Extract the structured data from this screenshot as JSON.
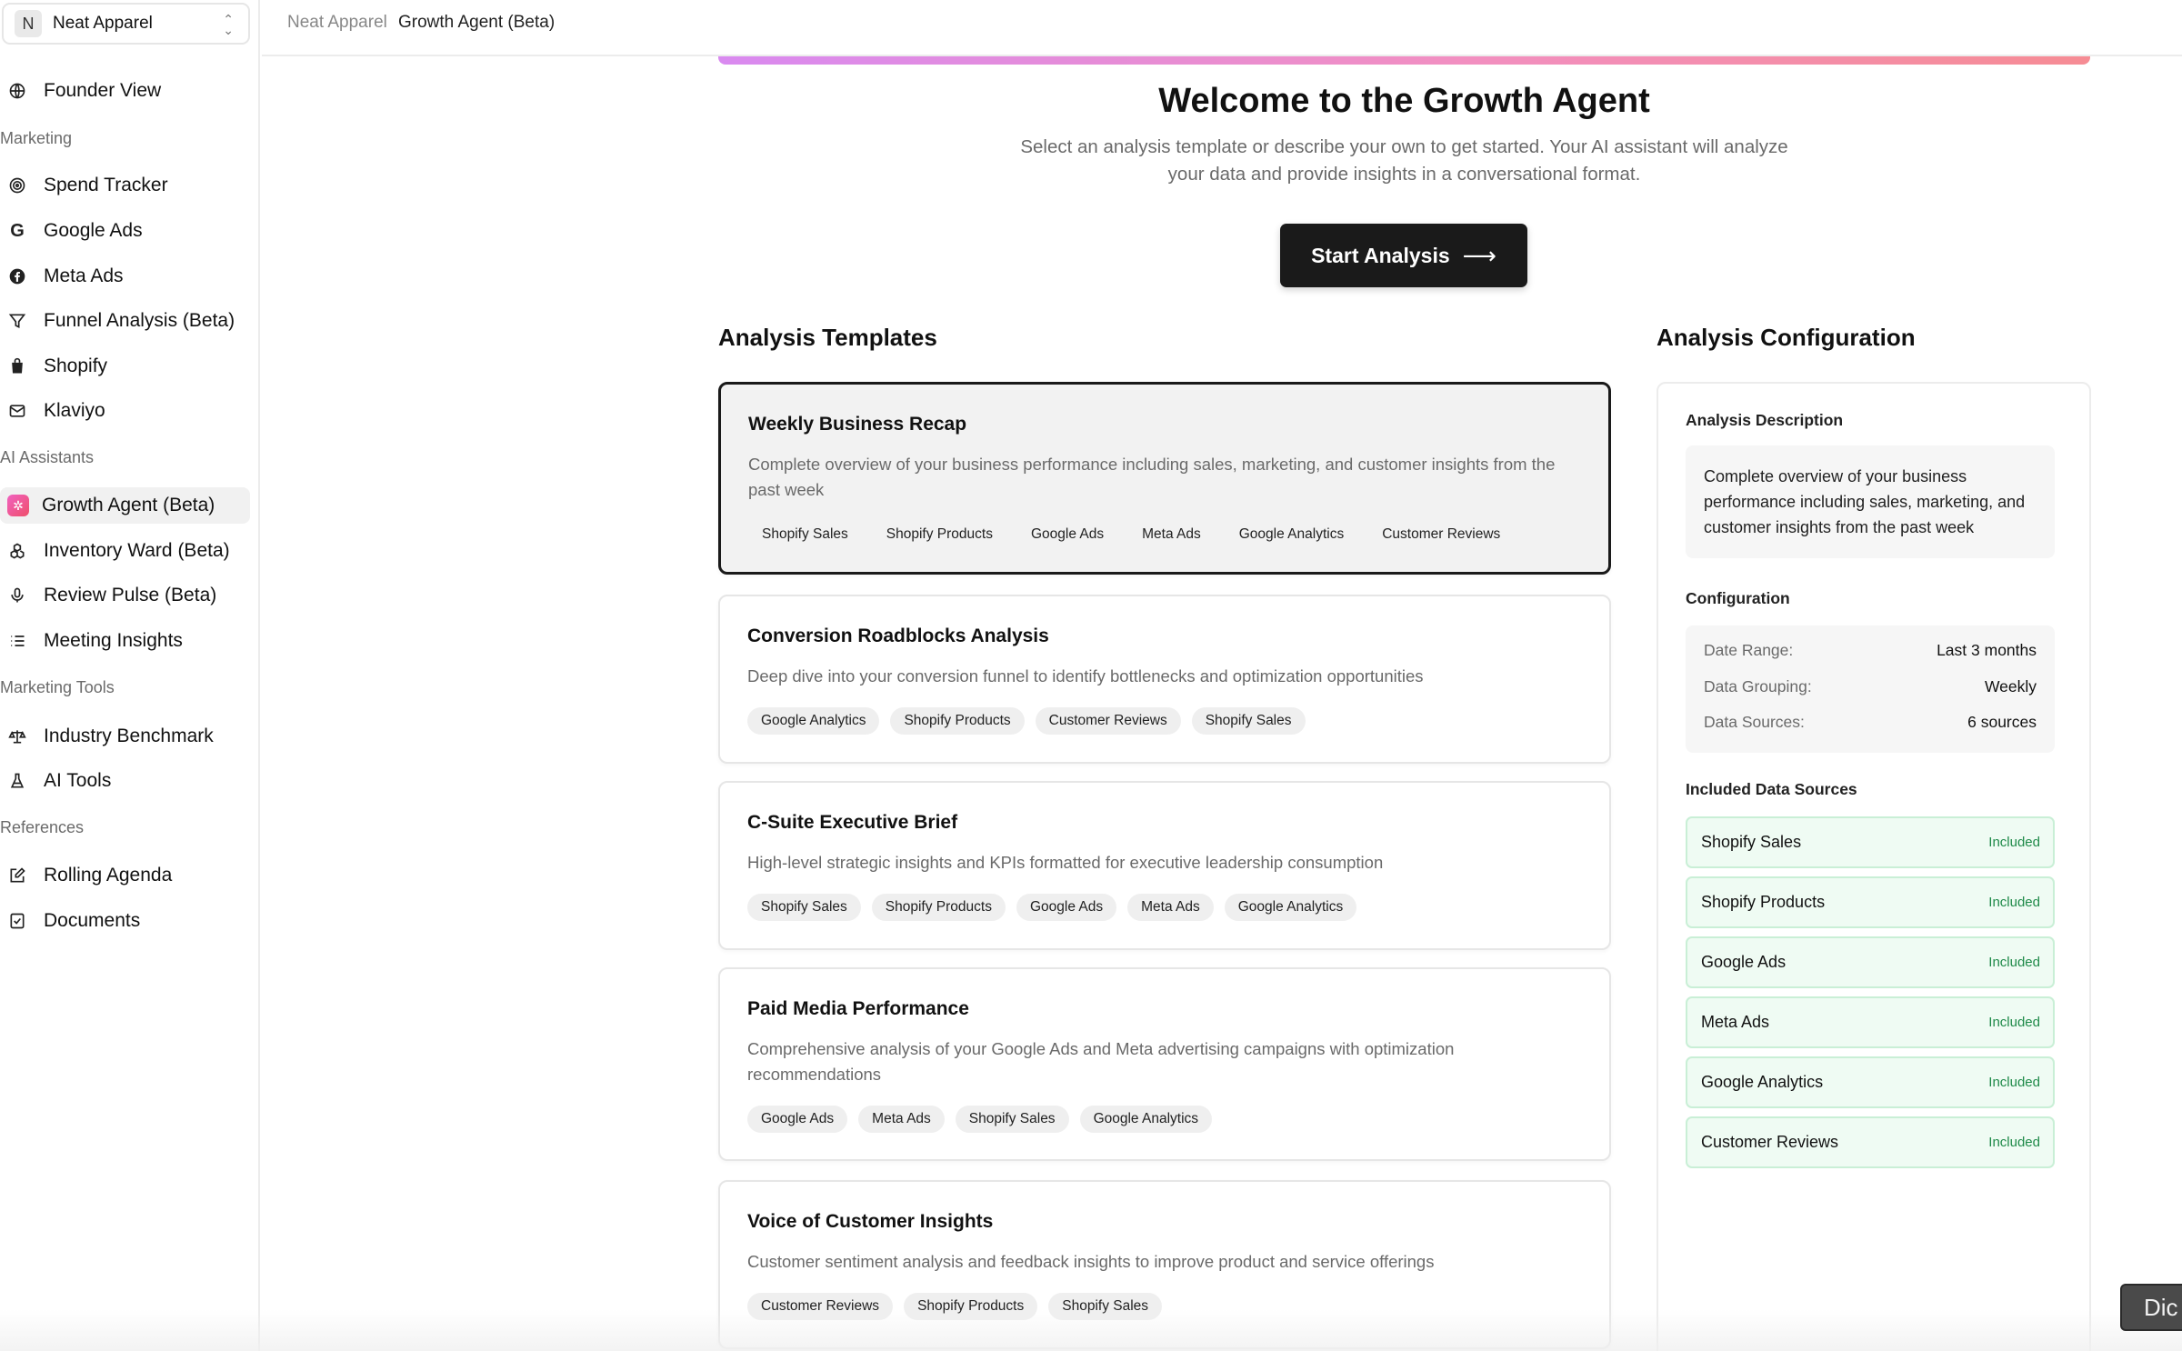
{
  "org": {
    "avatar": "N",
    "name": "Neat Apparel",
    "switch_icon": "chevron-up-down-icon"
  },
  "breadcrumb": {
    "parent": "Neat Apparel",
    "current": "Growth Agent (Beta)"
  },
  "sidebar": {
    "top_item": {
      "label": "Founder View",
      "icon": "globe-icon"
    },
    "sections": [
      {
        "title": "Marketing",
        "items": [
          {
            "label": "Spend Tracker",
            "icon": "target-icon"
          },
          {
            "label": "Google Ads",
            "icon": "google-icon"
          },
          {
            "label": "Meta Ads",
            "icon": "facebook-icon"
          },
          {
            "label": "Funnel Analysis (Beta)",
            "icon": "funnel-icon"
          },
          {
            "label": "Shopify",
            "icon": "shopify-bag-icon"
          },
          {
            "label": "Klaviyo",
            "icon": "mail-icon"
          }
        ]
      },
      {
        "title": "AI Assistants",
        "items": [
          {
            "label": "Growth Agent (Beta)",
            "icon": "sparkle-icon",
            "active": true
          },
          {
            "label": "Inventory Ward (Beta)",
            "icon": "boxes-icon"
          },
          {
            "label": "Review Pulse (Beta)",
            "icon": "microphone-icon"
          },
          {
            "label": "Meeting Insights",
            "icon": "list-icon"
          }
        ]
      },
      {
        "title": "Marketing Tools",
        "items": [
          {
            "label": "Industry Benchmark",
            "icon": "scale-icon"
          },
          {
            "label": "AI Tools",
            "icon": "flask-icon"
          }
        ]
      },
      {
        "title": "References",
        "items": [
          {
            "label": "Rolling Agenda",
            "icon": "edit-note-icon"
          },
          {
            "label": "Documents",
            "icon": "document-check-icon"
          }
        ]
      }
    ]
  },
  "welcome": {
    "title": "Welcome to the Growth Agent",
    "subtitle": "Select an analysis template or describe your own to get started. Your AI assistant will analyze your data and provide insights in a conversational format.",
    "start_button": "Start Analysis",
    "start_icon": "arrow-right-icon"
  },
  "templates": {
    "heading": "Analysis Templates",
    "items": [
      {
        "title": "Weekly Business Recap",
        "description": "Complete overview of your business performance including sales, marketing, and customer insights from the past week",
        "tags": [
          "Shopify Sales",
          "Shopify Products",
          "Google Ads",
          "Meta Ads",
          "Google Analytics",
          "Customer Reviews"
        ],
        "selected": true
      },
      {
        "title": "Conversion Roadblocks Analysis",
        "description": "Deep dive into your conversion funnel to identify bottlenecks and optimization opportunities",
        "tags": [
          "Google Analytics",
          "Shopify Products",
          "Customer Reviews",
          "Shopify Sales"
        ]
      },
      {
        "title": "C-Suite Executive Brief",
        "description": "High-level strategic insights and KPIs formatted for executive leadership consumption",
        "tags": [
          "Shopify Sales",
          "Shopify Products",
          "Google Ads",
          "Meta Ads",
          "Google Analytics"
        ]
      },
      {
        "title": "Paid Media Performance",
        "description": "Comprehensive analysis of your Google Ads and Meta advertising campaigns with optimization recommendations",
        "tags": [
          "Google Ads",
          "Meta Ads",
          "Shopify Sales",
          "Google Analytics"
        ]
      },
      {
        "title": "Voice of Customer Insights",
        "description": "Customer sentiment analysis and feedback insights to improve product and service offerings",
        "tags": [
          "Customer Reviews",
          "Shopify Products",
          "Shopify Sales"
        ]
      }
    ]
  },
  "configuration": {
    "heading": "Analysis Configuration",
    "description_label": "Analysis Description",
    "description": "Complete overview of your business performance including sales, marketing, and customer insights from the past week",
    "config_label": "Configuration",
    "rows": [
      {
        "key": "Date Range:",
        "value": "Last 3 months"
      },
      {
        "key": "Data Grouping:",
        "value": "Weekly"
      },
      {
        "key": "Data Sources:",
        "value": "6 sources"
      }
    ],
    "sources_label": "Included Data Sources",
    "sources": [
      {
        "name": "Shopify Sales",
        "status": "Included"
      },
      {
        "name": "Shopify Products",
        "status": "Included"
      },
      {
        "name": "Google Ads",
        "status": "Included"
      },
      {
        "name": "Meta Ads",
        "status": "Included"
      },
      {
        "name": "Google Analytics",
        "status": "Included"
      },
      {
        "name": "Customer Reviews",
        "status": "Included"
      }
    ]
  },
  "dictate_button": "Dic",
  "colors": {
    "accent_dark": "#1a1a1a",
    "included_green": "#1f8a49",
    "included_bg": "#effbf3",
    "gradient_start": "#d98af0",
    "gradient_end": "#f68c94"
  }
}
